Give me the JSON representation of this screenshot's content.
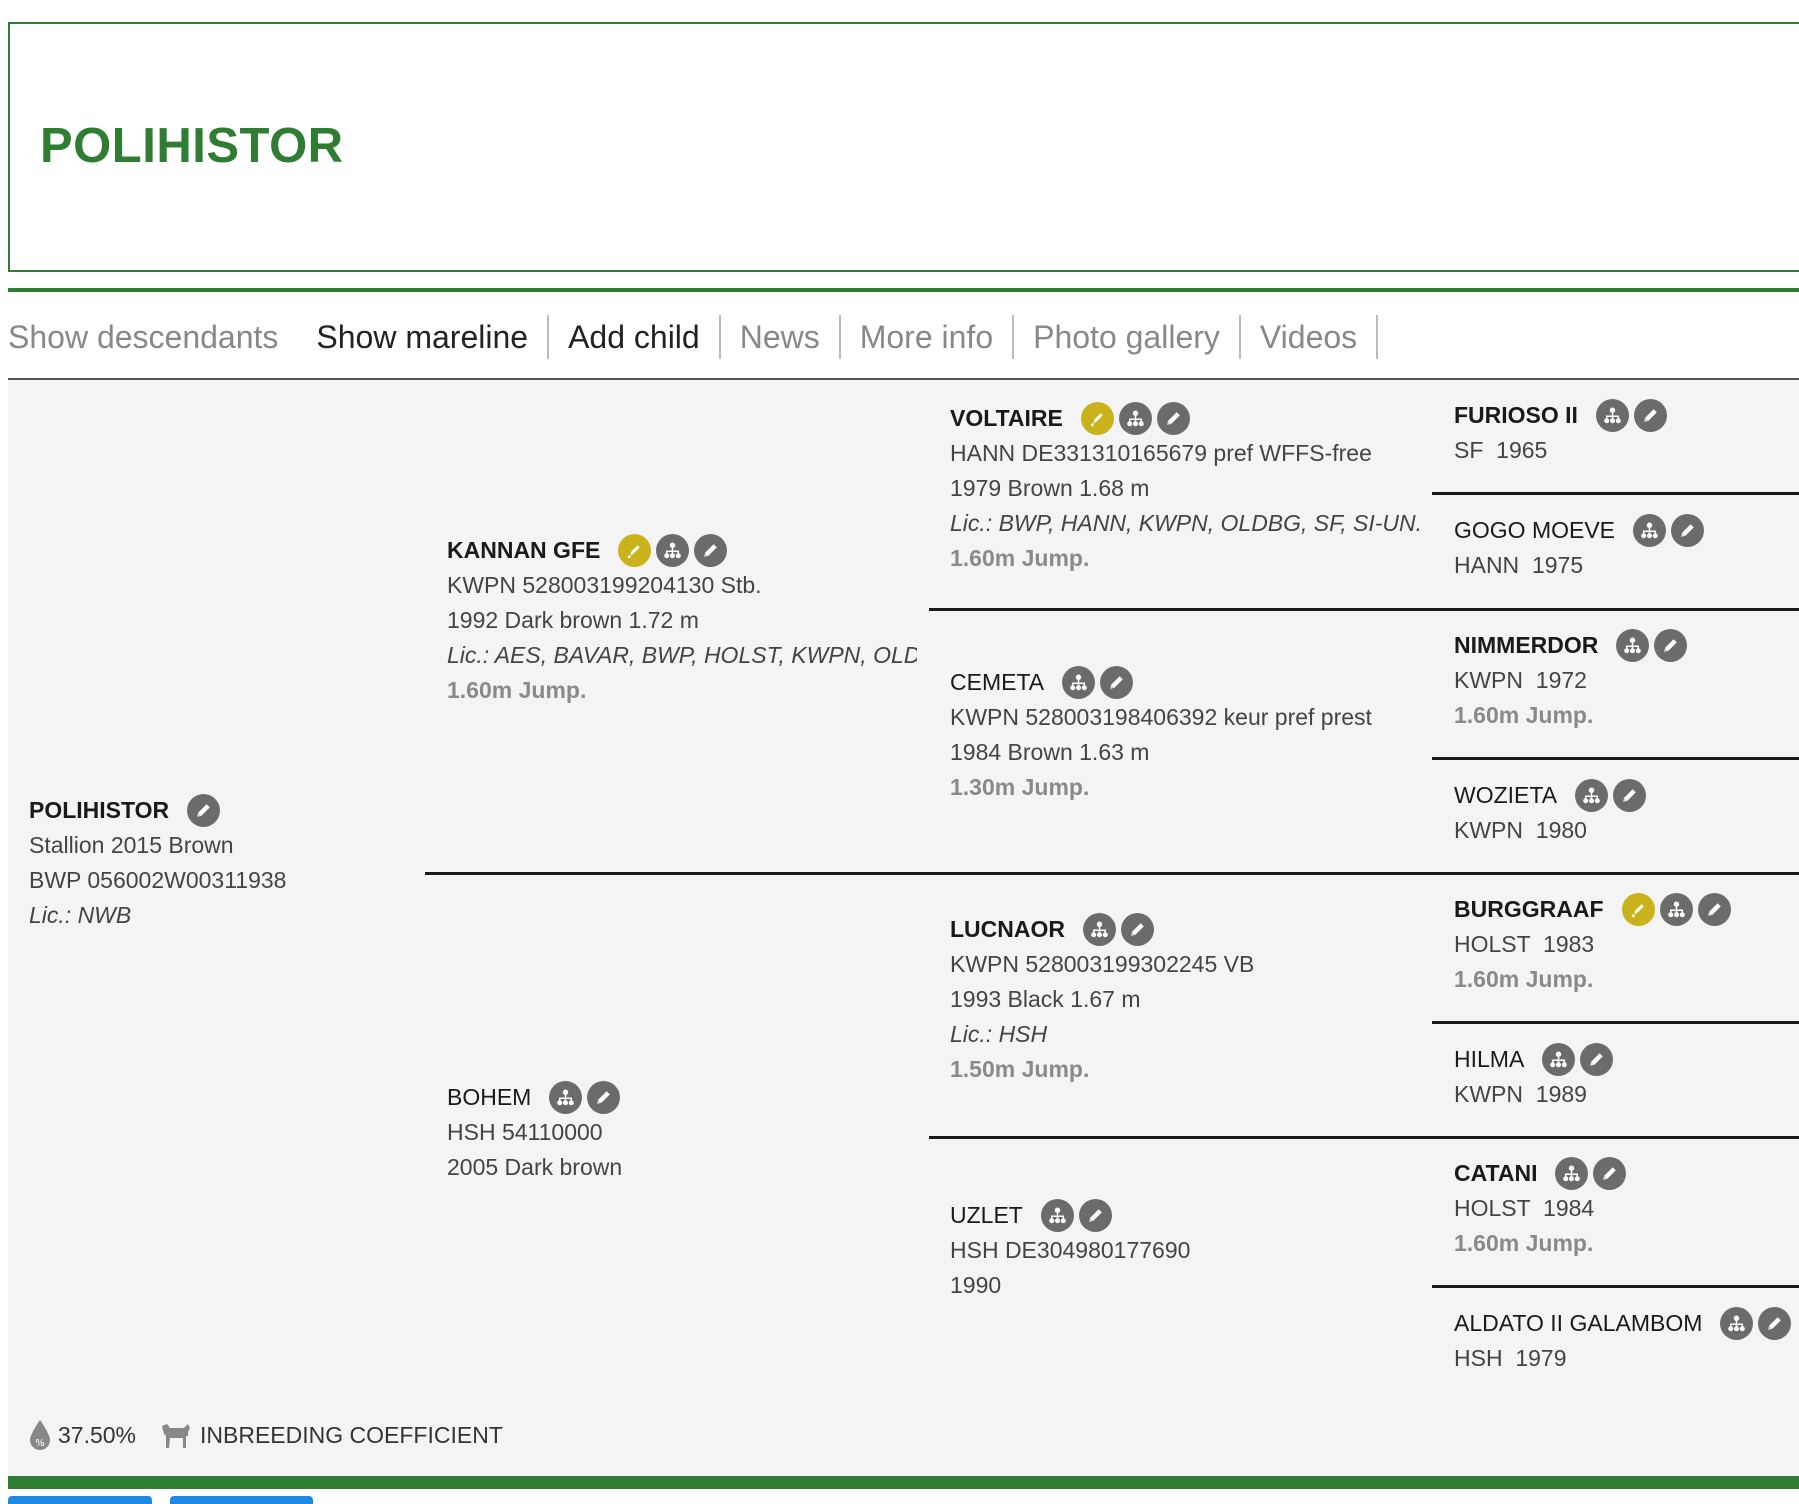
{
  "page": {
    "title": "POLIHISTOR"
  },
  "nav": {
    "items": [
      "Show descendants",
      "Show mareline",
      "Add child",
      "News",
      "More info",
      "Photo gallery",
      "Videos"
    ]
  },
  "icons": {
    "pencil": "pencil-icon",
    "tree": "family-tree-icon",
    "licence": "licence-pen-icon"
  },
  "colors": {
    "brand_green": "#2e7d32",
    "gold_icon": "#c9b21b",
    "grey_icon": "#6b6b6b",
    "link_blue": "#1e88e5"
  },
  "horses": {
    "subject": {
      "name": "POLIHISTOR",
      "line1": "Stallion 2015 Brown",
      "line2": "BWP 056002W00311938",
      "lic": "Lic.: NWB"
    },
    "sire": {
      "name": "KANNAN GFE",
      "line1": "KWPN 528003199204130 Stb.",
      "line2": "1992 Dark brown 1.72 m",
      "lic": "Lic.: AES, BAVAR, BWP, HOLST, KWPN, OLD...",
      "jump": "1.60m Jump."
    },
    "dam": {
      "name": "BOHEM",
      "line1": "HSH 54110000",
      "line2": "2005 Dark brown"
    },
    "ss": {
      "name": "VOLTAIRE",
      "line1": "HANN DE331310165679 pref WFFS-free",
      "line2": "1979 Brown 1.68 m",
      "lic": "Lic.: BWP, HANN, KWPN, OLDBG, SF, SI-UN...",
      "jump": "1.60m Jump."
    },
    "sd": {
      "name": "CEMETA",
      "line1": "KWPN 528003198406392 keur pref prest",
      "line2": "1984 Brown 1.63 m",
      "jump": "1.30m Jump."
    },
    "ds": {
      "name": "LUCNAOR",
      "line1": "KWPN 528003199302245 VB",
      "line2": "1993 Black 1.67 m",
      "lic": "Lic.: HSH",
      "jump": "1.50m Jump."
    },
    "dd": {
      "name": "UZLET",
      "line1": "HSH DE304980177690",
      "line2": "1990"
    },
    "sss": {
      "name": "FURIOSO II",
      "line1": "SF  1965"
    },
    "ssd": {
      "name": "GOGO MOEVE",
      "line1": "HANN  1975"
    },
    "sds": {
      "name": "NIMMERDOR",
      "line1": "KWPN  1972",
      "jump": "1.60m Jump."
    },
    "sdd": {
      "name": "WOZIETA",
      "line1": "KWPN  1980"
    },
    "dss": {
      "name": "BURGGRAAF",
      "line1": "HOLST  1983",
      "jump": "1.60m Jump."
    },
    "dsd": {
      "name": "HILMA",
      "line1": "KWPN  1989"
    },
    "dds": {
      "name": "CATANI",
      "line1": "HOLST  1984",
      "jump": "1.60m Jump."
    },
    "ddd": {
      "name": "ALDATO II GALAMBOM",
      "line1": "HSH  1979"
    }
  },
  "footer": {
    "percentage": "37.50%",
    "inbreeding_label": "INBREEDING COEFFICIENT"
  }
}
